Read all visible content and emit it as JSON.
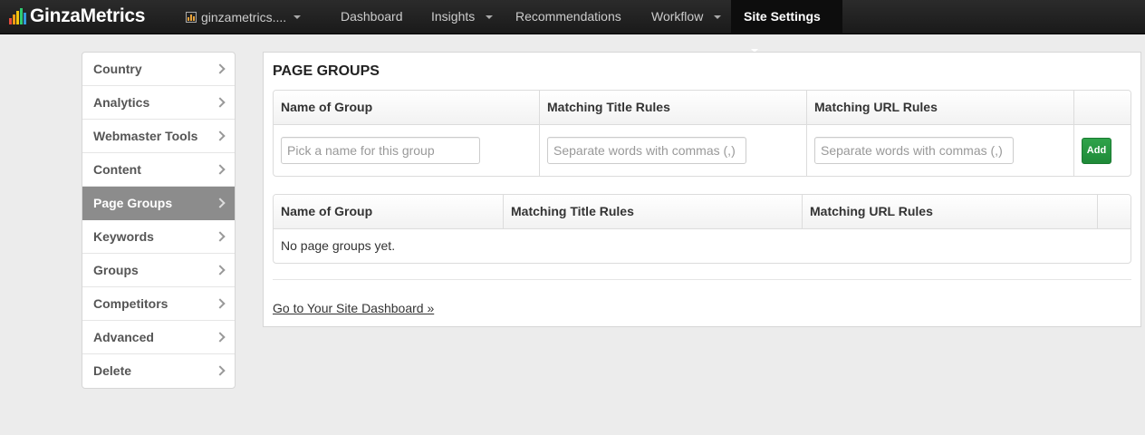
{
  "brand": {
    "name": "GinzaMetrics",
    "logo_colors": [
      "#e74c3c",
      "#f39c12",
      "#f1c40f",
      "#2ecc71",
      "#3498db"
    ]
  },
  "site_selector": {
    "label": "ginzametrics...."
  },
  "nav": {
    "items": [
      {
        "label": "Dashboard",
        "dropdown": false
      },
      {
        "label": "Insights",
        "dropdown": true
      },
      {
        "label": "Recommendations",
        "dropdown": false
      },
      {
        "label": "Workflow",
        "dropdown": true
      },
      {
        "label": "Site Settings",
        "dropdown": true,
        "active": true
      }
    ]
  },
  "sidebar": {
    "items": [
      {
        "label": "Country"
      },
      {
        "label": "Analytics"
      },
      {
        "label": "Webmaster Tools"
      },
      {
        "label": "Content"
      },
      {
        "label": "Page Groups",
        "active": true
      },
      {
        "label": "Keywords"
      },
      {
        "label": "Groups"
      },
      {
        "label": "Competitors"
      },
      {
        "label": "Advanced"
      },
      {
        "label": "Delete"
      }
    ]
  },
  "main": {
    "title": "PAGE GROUPS",
    "form_table": {
      "headers": [
        "Name of Group",
        "Matching Title Rules",
        "Matching URL Rules",
        ""
      ],
      "inputs": {
        "name_placeholder": "Pick a name for this group",
        "title_placeholder": "Separate words with commas (,)",
        "url_placeholder": "Separate words with commas (,)"
      },
      "add_label": "Add"
    },
    "list_table": {
      "headers": [
        "Name of Group",
        "Matching Title Rules",
        "Matching URL Rules",
        ""
      ],
      "empty_text": "No page groups yet."
    },
    "dashboard_link": "Go to Your Site Dashboard »"
  },
  "colors": {
    "accent_green": "#1f8a38",
    "active_sidebar": "#8c8c8c",
    "navbar": "#1a1a1a"
  }
}
